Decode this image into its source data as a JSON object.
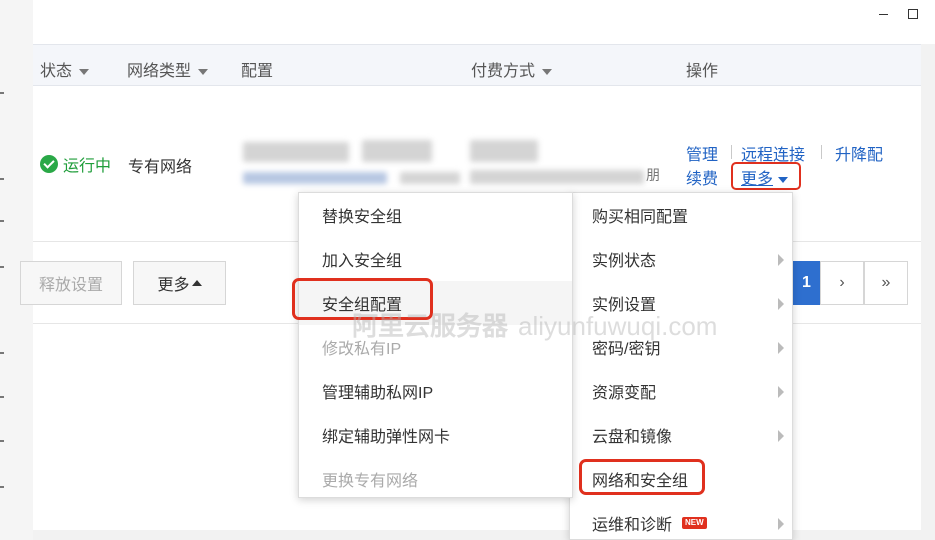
{
  "window": {
    "minimize_icon": "minimize-icon",
    "maximize_icon": "maximize-icon"
  },
  "table": {
    "headers": {
      "status": "状态",
      "network_type": "网络类型",
      "config": "配置",
      "billing": "付费方式",
      "actions": "操作"
    },
    "row": {
      "status": "运行中",
      "network_type": "专有网络",
      "billing_tail": "朋",
      "actions": {
        "manage": "管理",
        "remote": "远程连接",
        "upgrade": "升降配",
        "renew": "续费",
        "more": "更多"
      }
    }
  },
  "footer": {
    "release_button": "释放设置",
    "more_button": "更多",
    "pagination": {
      "current": "1",
      "next": "›",
      "last": "»"
    }
  },
  "menu_left": {
    "items": [
      {
        "label": "替换安全组",
        "disabled": false
      },
      {
        "label": "加入安全组",
        "disabled": false
      },
      {
        "label": "安全组配置",
        "disabled": false
      },
      {
        "label": "修改私有IP",
        "disabled": true
      },
      {
        "label": "管理辅助私网IP",
        "disabled": false
      },
      {
        "label": "绑定辅助弹性网卡",
        "disabled": false
      },
      {
        "label": "更换专有网络",
        "disabled": true
      }
    ]
  },
  "menu_right": {
    "items": [
      {
        "label": "购买相同配置",
        "submenu": false
      },
      {
        "label": "实例状态",
        "submenu": true
      },
      {
        "label": "实例设置",
        "submenu": true
      },
      {
        "label": "密码/密钥",
        "submenu": true
      },
      {
        "label": "资源变配",
        "submenu": true
      },
      {
        "label": "云盘和镜像",
        "submenu": true
      },
      {
        "label": "网络和安全组",
        "submenu": false
      },
      {
        "label": "运维和诊断",
        "submenu": true,
        "badge": "NEW"
      }
    ]
  },
  "watermark": {
    "brand": "阿里云服务器",
    "domain": "aliyunfuwuqi.com"
  },
  "colors": {
    "link": "#2163c4",
    "running": "#1f9d3a",
    "highlight": "#e0301e",
    "page_active": "#2e6fcf"
  }
}
